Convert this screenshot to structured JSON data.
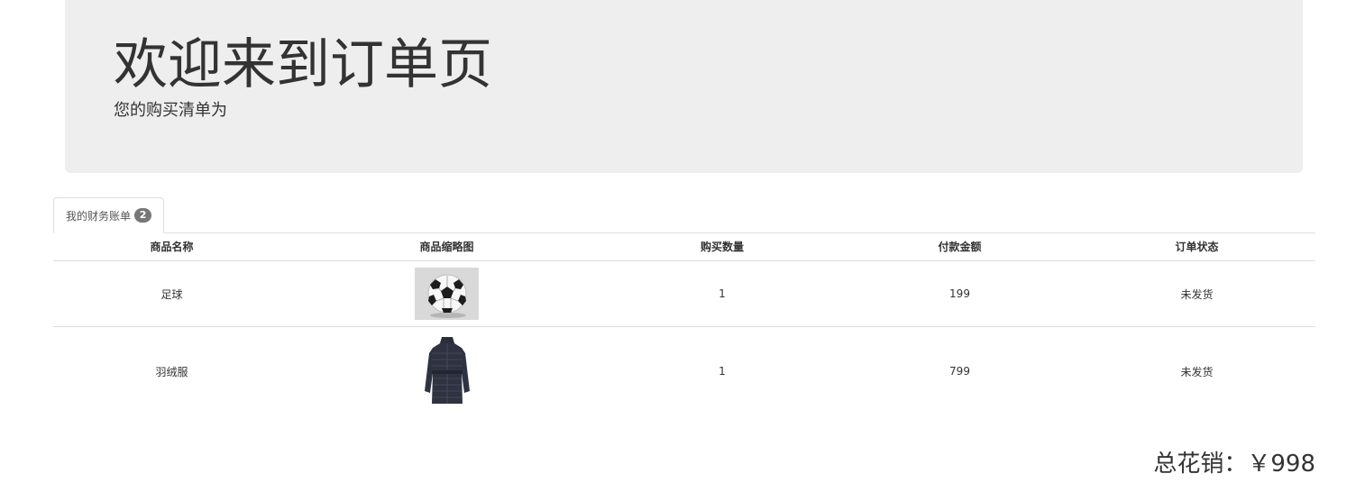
{
  "header": {
    "title": "欢迎来到订单页",
    "subtitle": "您的购买清单为"
  },
  "tabs": [
    {
      "label": "我的财务账单",
      "badge": "2"
    }
  ],
  "table": {
    "columns": [
      "商品名称",
      "商品缩略图",
      "购买数量",
      "付款金额",
      "订单状态"
    ],
    "rows": [
      {
        "name": "足球",
        "thumbnail_icon": "soccer-ball-image",
        "quantity": "1",
        "amount": "199",
        "status": "未发货"
      },
      {
        "name": "羽绒服",
        "thumbnail_icon": "down-coat-image",
        "quantity": "1",
        "amount": "799",
        "status": "未发货"
      }
    ]
  },
  "total": {
    "text": "总花销：￥998"
  },
  "colors": {
    "jumbotron_bg": "#eeeeee",
    "badge_bg": "#777777",
    "border": "#dddddd",
    "text": "#333333"
  }
}
